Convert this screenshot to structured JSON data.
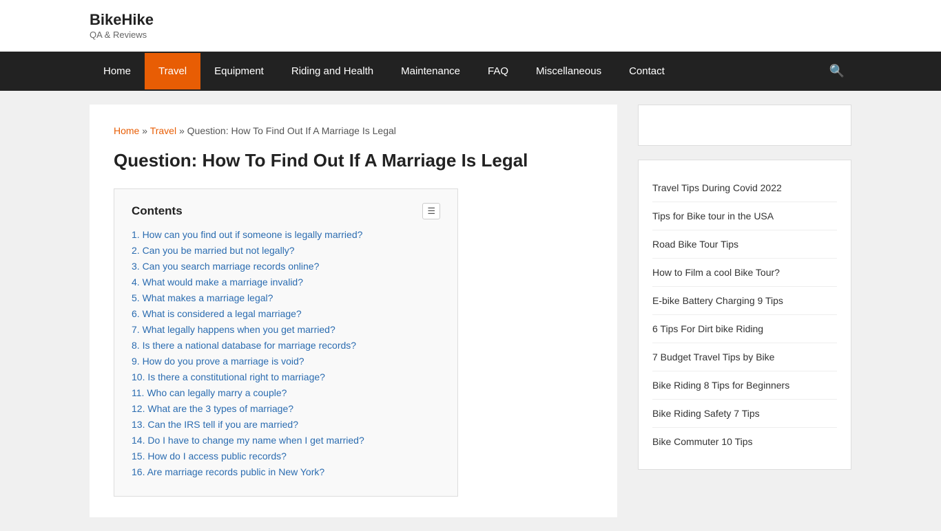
{
  "site": {
    "title": "BikeHike",
    "tagline": "QA & Reviews"
  },
  "nav": {
    "items": [
      {
        "label": "Home",
        "active": false
      },
      {
        "label": "Travel",
        "active": true
      },
      {
        "label": "Equipment",
        "active": false
      },
      {
        "label": "Riding and Health",
        "active": false
      },
      {
        "label": "Maintenance",
        "active": false
      },
      {
        "label": "FAQ",
        "active": false
      },
      {
        "label": "Miscellaneous",
        "active": false
      },
      {
        "label": "Contact",
        "active": false
      }
    ]
  },
  "breadcrumb": {
    "home": "Home",
    "separator": "»",
    "travel": "Travel",
    "current": "Question: How To Find Out If A Marriage Is Legal"
  },
  "article": {
    "title": "Question: How To Find Out If A Marriage Is Legal",
    "toc": {
      "title": "Contents",
      "toggle_label": "☰",
      "items": [
        "1. How can you find out if someone is legally married?",
        "2. Can you be married but not legally?",
        "3. Can you search marriage records online?",
        "4. What would make a marriage invalid?",
        "5. What makes a marriage legal?",
        "6. What is considered a legal marriage?",
        "7. What legally happens when you get married?",
        "8. Is there a national database for marriage records?",
        "9. How do you prove a marriage is void?",
        "10. Is there a constitutional right to marriage?",
        "11. Who can legally marry a couple?",
        "12. What are the 3 types of marriage?",
        "13. Can the IRS tell if you are married?",
        "14. Do I have to change my name when I get married?",
        "15. How do I access public records?",
        "16. Are marriage records public in New York?"
      ]
    }
  },
  "sidebar": {
    "links": [
      "Travel Tips During Covid 2022",
      "Tips for Bike tour in the USA",
      "Road Bike Tour Tips",
      "How to Film a cool Bike Tour?",
      "E-bike Battery Charging 9 Tips",
      "6 Tips For Dirt bike Riding",
      "7 Budget Travel Tips by Bike",
      "Bike Riding 8 Tips for Beginners",
      "Bike Riding Safety 7 Tips",
      "Bike Commuter 10 Tips"
    ]
  }
}
